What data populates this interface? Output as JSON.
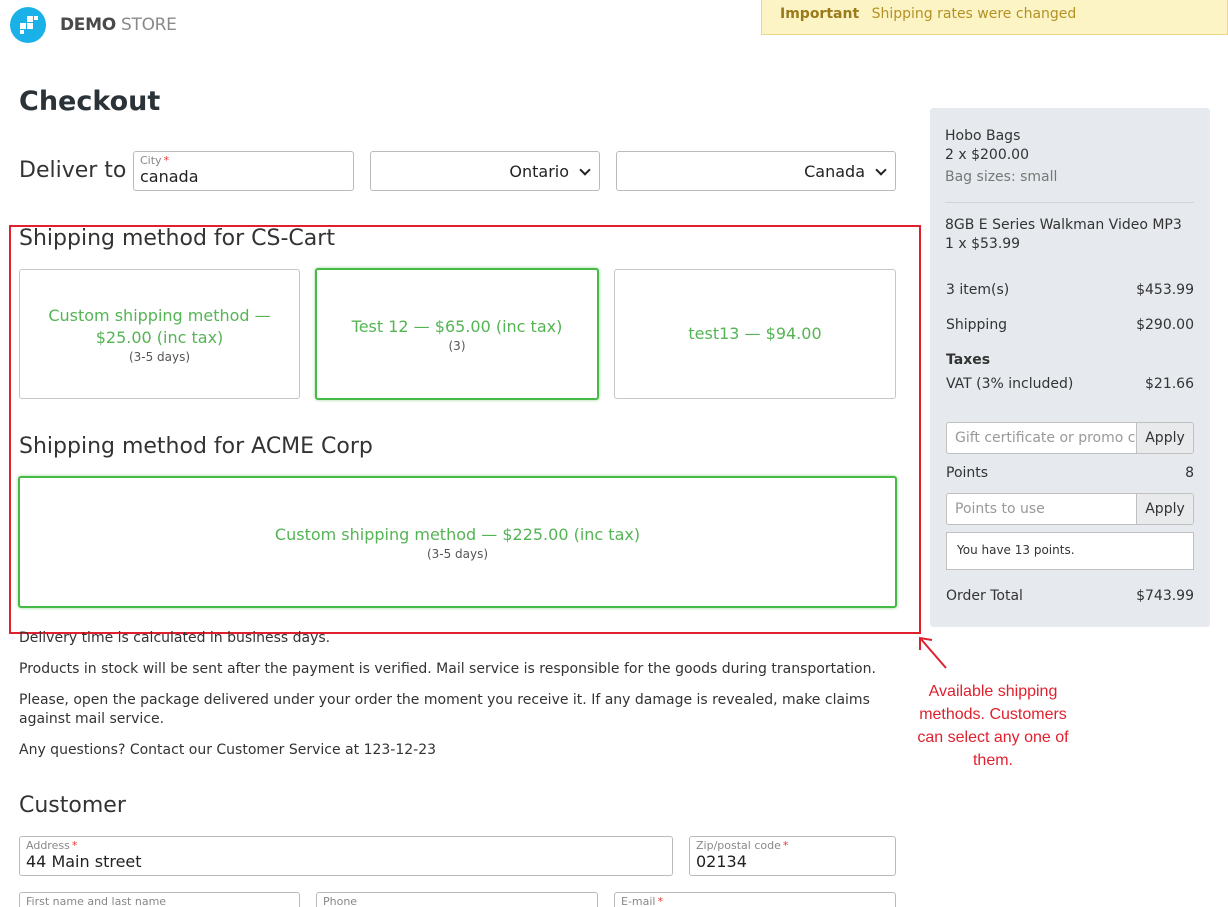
{
  "header": {
    "logo_bold": "DEMO",
    "logo_light": "STORE",
    "notice_title": "Important",
    "notice_text": "Shipping rates were changed"
  },
  "page_title": "Checkout",
  "deliver": {
    "label": "Deliver to",
    "city_label": "City",
    "city_value": "canada",
    "state_value": "Ontario",
    "country_value": "Canada"
  },
  "shipping": {
    "group1_title": "Shipping method for CS-Cart",
    "group1_options": [
      {
        "title": "Custom shipping method — $25.00 (inc tax)",
        "sub": "(3-5 days)",
        "selected": false
      },
      {
        "title": "Test 12 — $65.00 (inc tax)",
        "sub": "(3)",
        "selected": true
      },
      {
        "title": "test13 — $94.00",
        "sub": "",
        "selected": false
      }
    ],
    "group2_title": "Shipping method for ACME Corp",
    "group2_options": [
      {
        "title": "Custom shipping method — $225.00 (inc tax)",
        "sub": "(3-5 days)",
        "selected": true
      }
    ]
  },
  "info": {
    "delivery_time": "Delivery time is calculated in business days.",
    "stock": "Products in stock will be sent after the payment is verified. Mail service is responsible for the goods during transportation.",
    "damage": "Please, open the package delivered under your order the moment you receive it. If any damage is revealed, make claims against mail service.",
    "questions": "Any questions? Contact our Customer Service at 123-12-23"
  },
  "annotation": "Available shipping methods. Customers can select any one of them.",
  "sidebar": {
    "items": [
      {
        "name": "Hobo Bags",
        "qty": "2 x $200.00",
        "option": "Bag sizes: small"
      },
      {
        "name": "8GB E Series Walkman Video MP3",
        "qty": "1 x $53.99"
      }
    ],
    "items_label": "3 item(s)",
    "items_value": "$453.99",
    "shipping_label": "Shipping",
    "shipping_value": "$290.00",
    "taxes_label": "Taxes",
    "vat_label": "VAT (3% included)",
    "vat_value": "$21.66",
    "promo_placeholder": "Gift certificate or promo code",
    "apply_label": "Apply",
    "points_label": "Points",
    "points_value": "8",
    "points_placeholder": "Points to use",
    "points_note": "You have 13 points.",
    "total_label": "Order Total",
    "total_value": "$743.99"
  },
  "customer": {
    "title": "Customer",
    "address_label": "Address",
    "address_value": "44 Main street",
    "zip_label": "Zip/postal code",
    "zip_value": "02134",
    "name_label": "First name and last name",
    "phone_label": "Phone",
    "email_label": "E-mail"
  }
}
